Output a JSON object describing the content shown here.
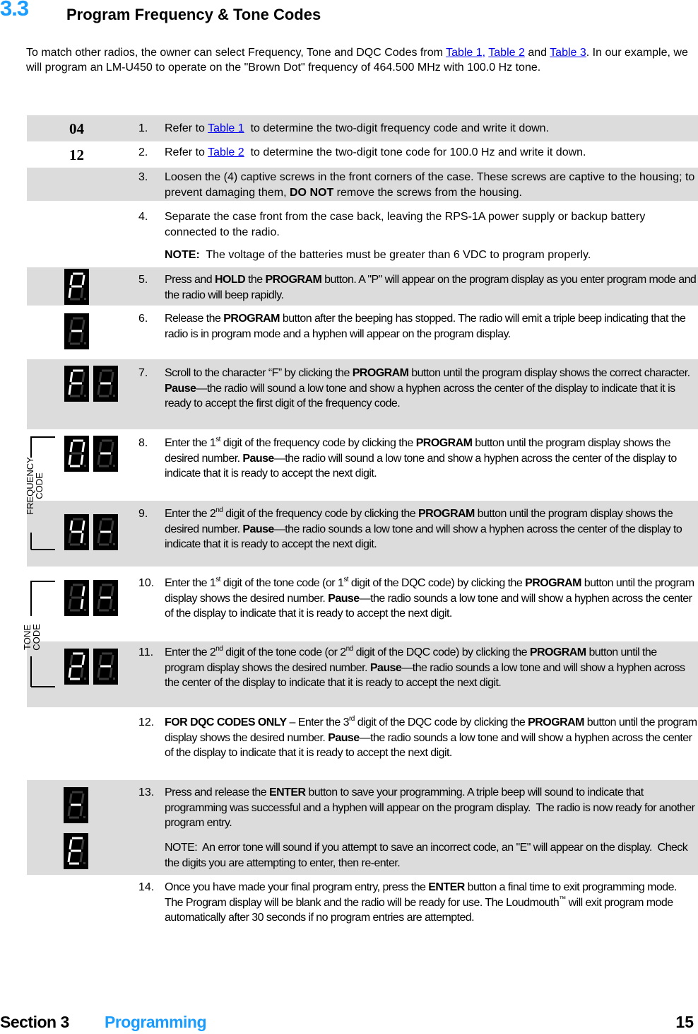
{
  "header": {
    "section_number": "3.3",
    "title": "Program Frequency & Tone Codes"
  },
  "intro": {
    "part1": "To match other radios, the owner can select Frequency, Tone and DQC Codes from ",
    "link1": "Table 1,",
    "sep1": " ",
    "link2": "Table 2",
    "sep2": " and ",
    "link3": "Table 3",
    "part2": ". In our example, we will program an LM-U450 to operate on the \"Brown Dot\" frequency of 464.500 MHz with 100.0 Hz tone."
  },
  "codes": {
    "frequency_code": "04",
    "tone_code": "12"
  },
  "bracket_labels": {
    "frequency": [
      "FREQUENCY",
      "CODE"
    ],
    "tone": [
      "TONE",
      "CODE"
    ]
  },
  "displays": {
    "step5": [
      "P"
    ],
    "step6": [
      "-"
    ],
    "step7": [
      "F",
      "-"
    ],
    "step8": [
      "0",
      "-"
    ],
    "step9": [
      "4",
      "-"
    ],
    "step10": [
      "1",
      "-"
    ],
    "step11": [
      "2",
      "-"
    ],
    "step13": [
      "-"
    ],
    "step13_note": [
      "E"
    ]
  },
  "steps": [
    {
      "n": "1.",
      "a": "Refer to ",
      "link": "Table 1",
      "b": "  to determine the two-digit frequency code and write it down."
    },
    {
      "n": "2.",
      "a": "Refer to ",
      "link": "Table 2",
      "b": "  to determine the two-digit tone code for 100.0 Hz and write it down."
    },
    {
      "n": "3.",
      "a": "Loosen the (4) captive screws in the front corners of the case. These screws are captive to the housing; to prevent damaging them, ",
      "bold": "DO NOT",
      "b": " remove the screws from the housing."
    },
    {
      "n": "4.",
      "a": "Separate the case front from the case back, leaving the RPS-1A power supply or backup battery connected to the radio.",
      "note_label": "NOTE:",
      "note": "  The voltage of the batteries must be greater than 6 VDC to program properly."
    },
    {
      "n": "5.",
      "a": "Press and ",
      "b1": "HOLD",
      "c": " the ",
      "b2": "PROGRAM",
      "d": " button. A \"P\" will appear on the program display as you enter program mode and the radio will beep rapidly."
    },
    {
      "n": "6.",
      "a": "Release the ",
      "b1": "PROGRAM",
      "c": " button after the beeping has stopped. The radio will emit a triple beep indicating that the radio is in program mode and a hyphen will appear on the program display."
    },
    {
      "n": "7.",
      "a": "Scroll to the character “F” by clicking the ",
      "b1": "PROGRAM",
      "c": " button until the program display shows the correct character. ",
      "b2": "Pause",
      "d": "—the radio will sound a low tone and show a hyphen across the center of the display to indicate that it is ready to accept the first digit of the frequency code."
    },
    {
      "n": "8.",
      "a": "Enter the 1",
      "sup1": "st",
      "c": " digit of the frequency code by clicking the ",
      "b1": "PROGRAM",
      "d": " button until the program display shows the desired number. ",
      "b2": "Pause",
      "e": "—the radio will sound a low tone and show a hyphen across the center of the display to indicate that it is ready to accept the next digit."
    },
    {
      "n": "9.",
      "a": "Enter the 2",
      "sup1": "nd",
      "c": " digit of the frequency code by clicking the ",
      "b1": "PROGRAM",
      "d": " button until the program display shows the desired number. ",
      "b2": "Pause",
      "e": "—the radio sounds a low tone and will show a hyphen across the center of the display to indicate that it is ready to accept the next digit."
    },
    {
      "n": "10.",
      "a": "Enter the 1",
      "sup1": "st",
      "c": " digit of the tone code (or 1",
      "sup2": "st",
      "d": " digit of the DQC code) by clicking the ",
      "b1": "PROGRAM",
      "e": " button until the program display shows the desired number. ",
      "b2": "Pause",
      "f": "—the radio sounds a low tone and will show a hyphen across the center of the display to indicate that it is ready to accept the next digit."
    },
    {
      "n": "11.",
      "a": "Enter the 2",
      "sup1": "nd",
      "c": " digit of the tone code (or 2",
      "sup2": "nd",
      "d": " digit of the DQC code) by clicking the ",
      "b1": "PROGRAM",
      "e": " button until the program display shows the desired number. ",
      "b2": "Pause",
      "f": "—the radio sounds a low tone and will show a hyphen across the center of the display to indicate that it is ready to accept the next digit."
    },
    {
      "n": "12.",
      "b0": "FOR DQC CODES ONLY",
      "a": " – Enter the 3",
      "sup1": "rd",
      "c": " digit of the DQC code by clicking the ",
      "b1": "PROGRAM",
      "e": " button until the program display shows the desired number. ",
      "b2": "Pause",
      "f": "—the radio sounds a low tone and will show a hyphen across the center of the display to indicate that it is ready to accept the next digit."
    },
    {
      "n": "13.",
      "a": "Press and release the ",
      "b1": "ENTER",
      "c": " button to save your programming. A triple beep will sound to indicate that programming was successful and a hyphen will appear on the program display.  The radio is now ready for another program entry.",
      "note": "NOTE:  An error tone will sound if you attempt to save an incorrect code, an \"E\" will appear on the display.  Check the digits you are attempting to enter, then re-enter."
    },
    {
      "n": "14.",
      "a": "Once you have made your final program entry, press the ",
      "b1": "ENTER",
      "c": " button a final time to exit programming mode.  The Program display will be blank and the radio will be ready for use. The Loudmouth",
      "sup1": "™",
      "d": " will exit program mode automatically after 30 seconds if no program entries are attempted."
    }
  ],
  "footer": {
    "section": "Section 3",
    "name": "Programming",
    "page": "15"
  }
}
